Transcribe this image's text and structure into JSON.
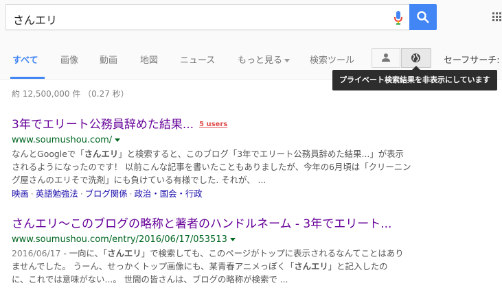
{
  "search": {
    "query": "さんエリ"
  },
  "tabs": [
    "すべて",
    "画像",
    "動画",
    "地図",
    "ニュース",
    "もっと見る",
    "検索ツール",
    "セーフサーチ:"
  ],
  "tooltip": "プライベート検索結果を非表示にしています",
  "stats": "約 12,500,000 件 （0.27 秒）",
  "results": [
    {
      "title": "3年でエリート公務員辞めた結果...",
      "badge": "5 users",
      "url": "www.soumushou.com/",
      "snippet_lines": [
        [
          "なんとGoogleで「",
          "さんエリ",
          "」と検索すると、このブログ「3年でエリート公務員辞めた結果...」が表示"
        ],
        [
          "されるようになったのです！ 以前こんな記事を書いたこともありましたが、今年の6月頃は「クリーニン"
        ],
        [
          "グ屋さんのエリそで洗剤」にも負けている有様でした. それが、 ..."
        ]
      ],
      "sitelinks": [
        "映画",
        "英語勉強法",
        "ブログ関係",
        "政治・国会・行政"
      ]
    },
    {
      "title": "さんエリ～このブログの略称と著者のハンドルネーム - 3年でエリート...",
      "url": "www.soumushou.com/entry/2016/06/17/053513",
      "date": "2016/06/17",
      "snippet_lines": [
        [
          " - 一向に、「",
          "さんエリ",
          "」で検索しても、このページがトップに表示されるなんてことはあり"
        ],
        [
          "ませんでした。 うーん、せっかくトップ画像にも、某青春アニメっぽく「",
          "さんエリ",
          "」と記入したの"
        ],
        [
          "に、これでは意味がない...。 世間の皆さんは、ブログの略称が検索で ..."
        ]
      ]
    }
  ],
  "colors": {
    "accent": "#4285f4",
    "visited": "#660099",
    "url": "#006621",
    "link": "#1a0dab"
  }
}
